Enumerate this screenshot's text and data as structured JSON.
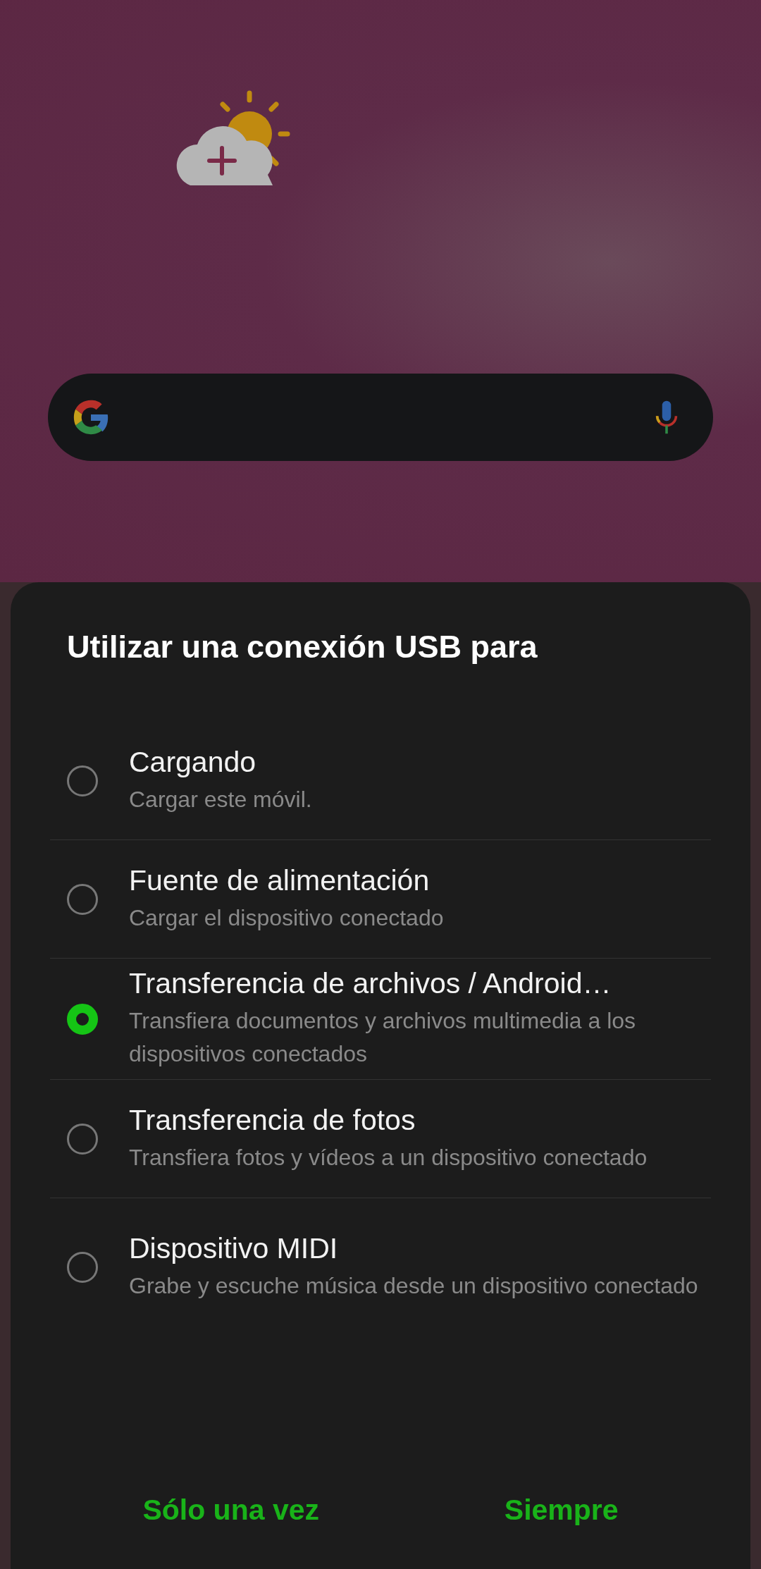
{
  "home_screen": {
    "search_bar": {
      "kind": "google"
    }
  },
  "dialog": {
    "title": "Utilizar una conexión USB para",
    "options": [
      {
        "label": "Cargando",
        "description": "Cargar este móvil.",
        "selected": false
      },
      {
        "label": "Fuente de alimentación",
        "description": "Cargar el dispositivo conectado",
        "selected": false
      },
      {
        "label": "Transferencia de archivos / Android…",
        "description": "Transfiera documentos y archivos multimedia a los dispositivos conectados",
        "selected": true
      },
      {
        "label": "Transferencia de fotos",
        "description": "Transfiera fotos y vídeos a un dispositivo conectado",
        "selected": false
      },
      {
        "label": "Dispositivo MIDI",
        "description": "Grabe y escuche música desde un dispositivo conectado",
        "selected": false
      }
    ],
    "buttons": [
      "Sólo una vez",
      "Siempre"
    ]
  }
}
